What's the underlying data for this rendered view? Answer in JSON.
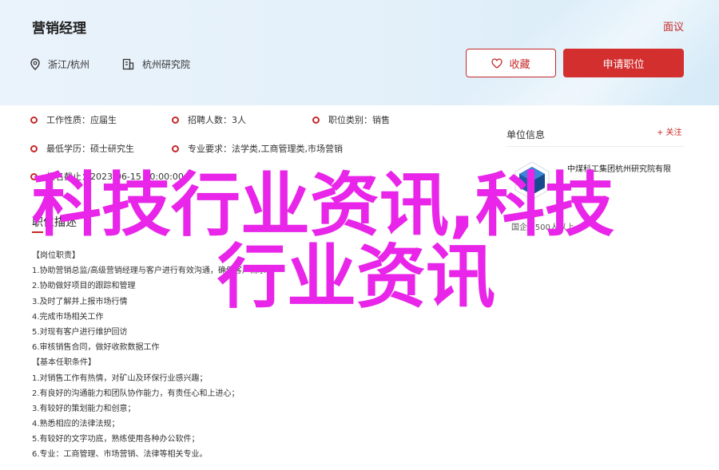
{
  "header": {
    "title": "营销经理",
    "report_label": "面议",
    "location": "浙江/杭州",
    "organization": "杭州研究院",
    "favorite_label": "收藏",
    "apply_label": "申请职位"
  },
  "info": {
    "work_type_label": "工作性质：",
    "work_type_value": "应届生",
    "recruit_count_label": "招聘人数：",
    "recruit_count_value": "3人",
    "category_label": "职位类别：",
    "category_value": "销售",
    "education_label": "最低学历：",
    "education_value": "硕士研究生",
    "major_label": "专业要求：",
    "major_value": "法学类,工商管理类,市场营销",
    "deadline_label": "报名截止：",
    "deadline_value": "2023-06-15 00:00:00"
  },
  "section_title": "职位描述",
  "description": [
    "【岗位职责】",
    "1.协助营销总监/高级营销经理与客户进行有效沟通，确保客户需求",
    "2.协助做好项目的跟踪和管理",
    "3.及时了解并上报市场行情",
    "4.完成市场相关工作",
    "5.对现有客户进行维护回访",
    "6.审核销售合同，做好收款数据工作",
    "【基本任职条件】",
    "1.对销售工作有热情，对矿山及环保行业感兴趣；",
    "2.有良好的沟通能力和团队协作能力，有责任心和上进心；",
    "3.有较好的策划能力和创意；",
    "4.熟悉相应的法律法规；",
    "5.有较好的文字功底，熟练使用各种办公软件；",
    "6.专业：工商管理、市场营销、法律等相关专业。"
  ],
  "sidebar": {
    "title": "单位信息",
    "follow_label": "+ 关注",
    "company_name": "中煤科工集团杭州研究院有限",
    "company_info": "国企 | 500人以上"
  },
  "overlay": {
    "line1": "科技行业资讯,科技",
    "line2": "行业资讯"
  },
  "colors": {
    "accent": "#c62828",
    "overlay": "#e825e8"
  }
}
